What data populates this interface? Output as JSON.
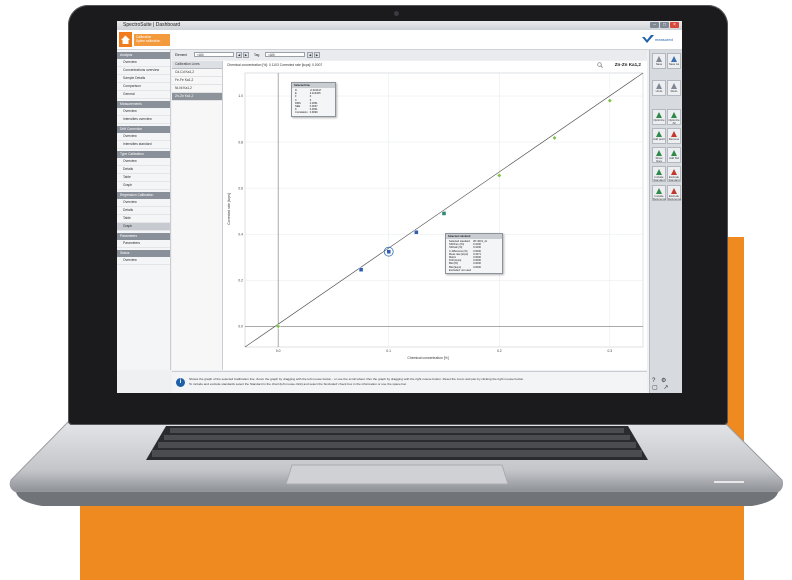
{
  "window": {
    "title": "SpectroSuite | Dashboard"
  },
  "header": {
    "breadcrumb_line1": "Calibration",
    "breadcrumb_line2": "Spline calibration",
    "brand": "measured",
    "accent_color": "#f07c1b"
  },
  "sidebar": {
    "sections": [
      {
        "title": "Analysis",
        "items": [
          "Overview",
          "Concentrations overview",
          "Sample Details",
          "Comparison",
          "General"
        ]
      },
      {
        "title": "Measurements",
        "items": [
          "Overview",
          "Intensities overview"
        ]
      },
      {
        "title": "Drift Correction",
        "items": [
          "Overview",
          "Intensities standard"
        ]
      },
      {
        "title": "Type Calibration",
        "items": [
          "Overview",
          "Details",
          "Table",
          "Graph"
        ]
      },
      {
        "title": "Regression Calibration",
        "items": [
          "Overview",
          "Details",
          "Table",
          "Graph"
        ]
      },
      {
        "title": "Parameters",
        "items": [
          "Parameters"
        ]
      },
      {
        "title": "Status",
        "items": [
          "Overview"
        ]
      }
    ],
    "active_item": "Graph"
  },
  "toolbar": {
    "element_label": "Element",
    "element_value": "<All>",
    "tag_label": "Tag",
    "tag_value": "<All>"
  },
  "calibration_lines": {
    "header": "Calibration Lines",
    "items": [
      "Cd-Cd Ka1,2",
      "Fe-Fe Ka1,2",
      "Ni-Ni Ka1,2",
      "Zn-Zn Ka1,2"
    ],
    "selected_index": 3
  },
  "chart_header": {
    "info": "Chemical concentration [%]: 0.1103    Corrected rate [kcps]: 0.0007",
    "calibration_name": "Zn-Zn Ka1,2"
  },
  "chart_data": {
    "type": "scatter",
    "xlabel": "Chemical concentration [%]",
    "ylabel": "Corrected rate [kcps]",
    "x_ticks": [
      "0.0",
      "0.1",
      "0.2",
      "0.3"
    ],
    "y_ticks": [
      "0.0",
      "0.2",
      "0.4",
      "0.6",
      "0.8",
      "1.0"
    ],
    "xlim": [
      -0.03,
      0.33
    ],
    "ylim": [
      -0.09,
      1.1
    ],
    "regression_line": [
      [
        -0.03,
        -0.09
      ],
      [
        0.33,
        1.1
      ]
    ],
    "points": [
      {
        "x": 0.0,
        "y": 0.0,
        "status": "used"
      },
      {
        "x": 0.075,
        "y": 0.246,
        "status": "selected"
      },
      {
        "x": 0.1,
        "y": 0.324,
        "status": "selected"
      },
      {
        "x": 0.125,
        "y": 0.408,
        "status": "selected"
      },
      {
        "x": 0.15,
        "y": 0.49,
        "status": "excluded"
      },
      {
        "x": 0.2,
        "y": 0.655,
        "status": "used"
      },
      {
        "x": 0.25,
        "y": 0.818,
        "status": "used"
      },
      {
        "x": 0.3,
        "y": 0.98,
        "status": "used"
      }
    ],
    "highlighted_index": 2
  },
  "popups": {
    "line": {
      "title": "Selected line",
      "rows": [
        [
          "D",
          "-0.001617"
        ],
        [
          "E",
          "3.213465"
        ],
        [
          "F",
          "0"
        ],
        [
          "0",
          "0"
        ],
        [
          "RMS",
          "0.0051"
        ],
        [
          "SEE",
          "0.0037"
        ],
        [
          "K",
          "0.0001"
        ],
        [
          "Correlation",
          "0.9999"
        ]
      ]
    },
    "standard": {
      "title": "Selected standard",
      "rows": [
        [
          "Selected standard",
          "ZP-4001_2c"
        ],
        [
          "SDChem [%]",
          "0.1000"
        ],
        [
          "SDCalc [%]",
          "0.1000"
        ],
        [
          "C difference [%]",
          "0.0000"
        ],
        [
          "Meas rate [kcps]",
          "0.3471"
        ],
        [
          "Matrix",
          "0.0000"
        ],
        [
          "Drift [kcps]",
          "0.0000"
        ],
        [
          "Bkd [%]",
          "0.0000"
        ],
        [
          "Bkd [kcps]",
          "0.0000"
        ],
        [
          "Excluded: not used",
          ""
        ]
      ]
    }
  },
  "ribbon": {
    "buttons": [
      "Save",
      "Save As",
      "Undo",
      "Redo",
      "Optimize",
      "Optimize All",
      "Add point",
      "Remove",
      "Show lines",
      "Add Std",
      "Include Standard",
      "Exclude Standard",
      "Include Reference",
      "Exclude Reference"
    ]
  },
  "status": {
    "line1": "Shows the graph of the selected Calibration line. Zoom the graph by dragging with the left mouse button - or use the scroll wheel. Pan the graph by dragging with the right mouse button. Reset the zoom and pan by clicking the right mouse button.",
    "line2": "To include and exclude standards select the Standard in the chart (left mouse click) and select the 'Excluded' check box in the information or use the space bar."
  }
}
